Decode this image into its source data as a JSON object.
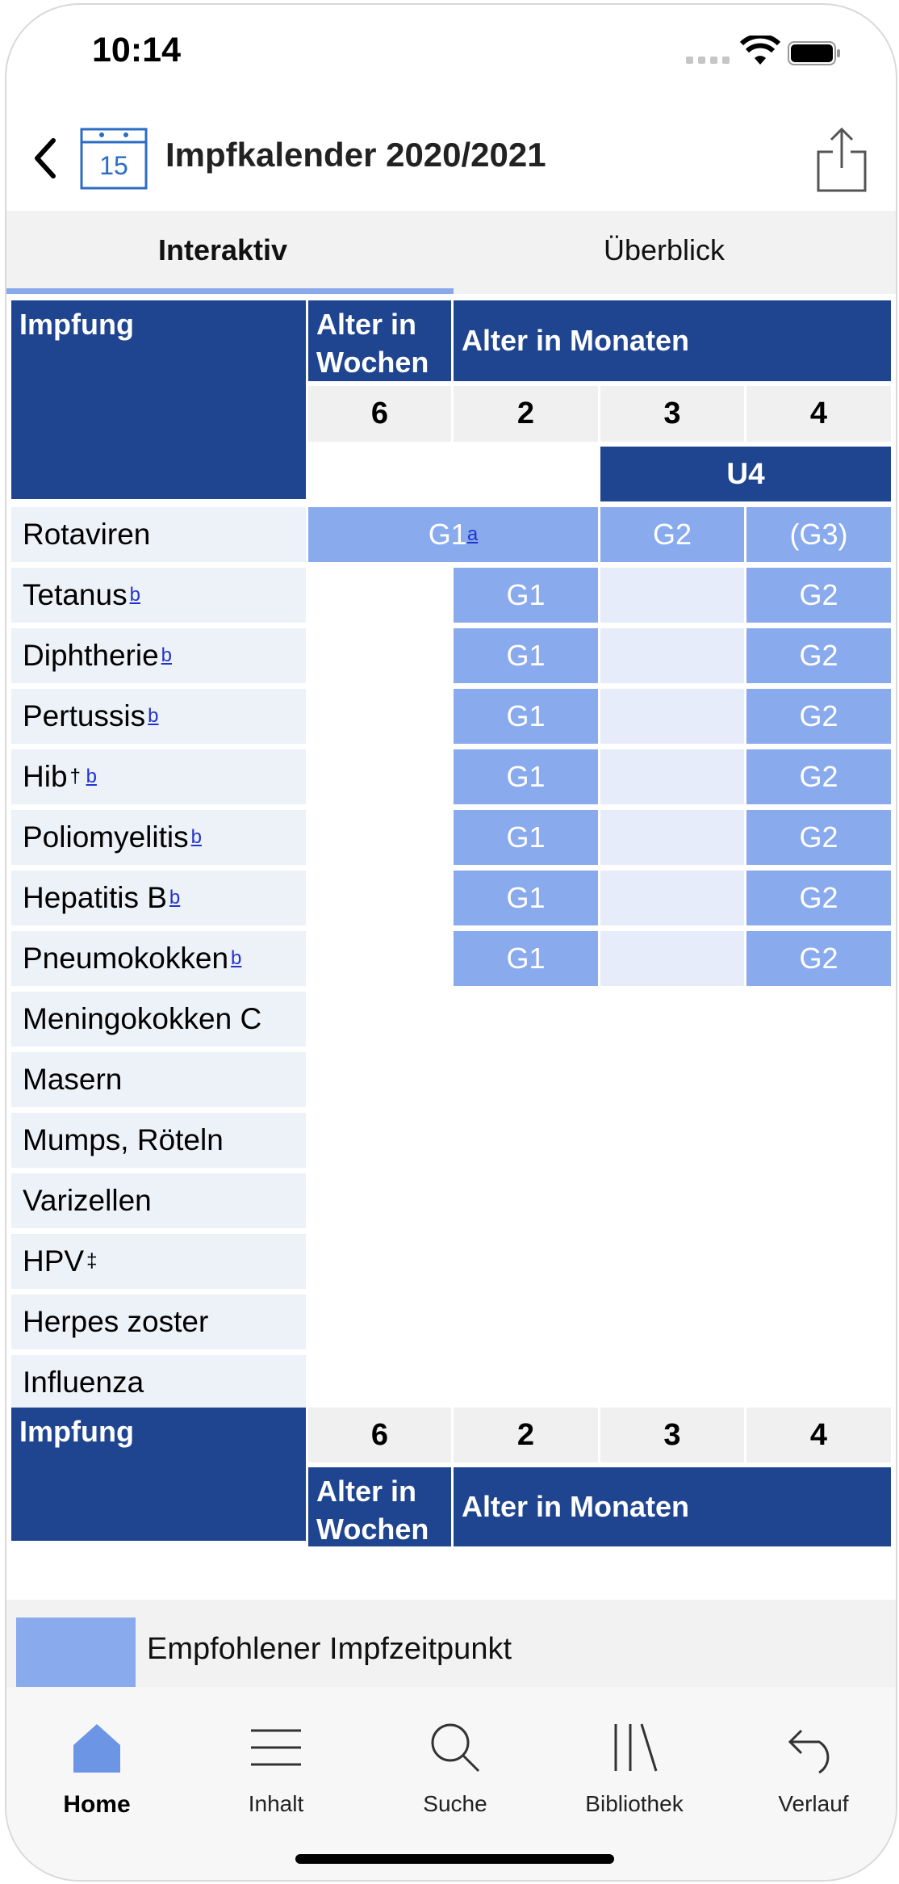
{
  "status_bar": {
    "time": "10:14"
  },
  "nav": {
    "title": "Impfkalender 2020/2021",
    "calendar_day": "15"
  },
  "tabs": [
    {
      "label": "Interaktiv",
      "active": true
    },
    {
      "label": "Überblick",
      "active": false
    }
  ],
  "table": {
    "header_impfung": "Impfung",
    "header_weeks": "Alter in Wochen",
    "header_months": "Alter in Monaten",
    "ages": [
      "6",
      "2",
      "3",
      "4"
    ],
    "u_label": "U4",
    "rotaviren": {
      "label": "Rotaviren",
      "g1": "G1",
      "g1_footnote": "a",
      "g2": "G2",
      "g3": "(G3)"
    },
    "rows": [
      {
        "label": "Tetanus",
        "sup": "b",
        "sup_prefix": "",
        "g1": "G1",
        "g2": "G2"
      },
      {
        "label": "Diphtherie",
        "sup": "b",
        "sup_prefix": "",
        "g1": "G1",
        "g2": "G2"
      },
      {
        "label": "Pertussis",
        "sup": "b",
        "sup_prefix": "",
        "g1": "G1",
        "g2": "G2"
      },
      {
        "label": "Hib",
        "sup": "b",
        "sup_prefix": "†",
        "g1": "G1",
        "g2": "G2"
      },
      {
        "label": "Poliomyelitis",
        "sup": "b",
        "sup_prefix": "",
        "g1": "G1",
        "g2": "G2"
      },
      {
        "label": "Hepatitis B",
        "sup": "b",
        "sup_prefix": "",
        "g1": "G1",
        "g2": "G2"
      },
      {
        "label": "Pneumokokken",
        "sup": "b",
        "sup_prefix": "",
        "g1": "G1",
        "g2": "G2"
      }
    ],
    "other_rows": [
      {
        "label": "Meningokokken C",
        "sup": ""
      },
      {
        "label": "Masern",
        "sup": ""
      },
      {
        "label": "Mumps, Röteln",
        "sup": ""
      },
      {
        "label": "Varizellen",
        "sup": ""
      },
      {
        "label": "HPV",
        "sup": "‡"
      },
      {
        "label": "Herpes zoster",
        "sup": ""
      },
      {
        "label": "Influenza",
        "sup": ""
      }
    ]
  },
  "legend": {
    "text": "Empfohlener Impfzeitpunkt"
  },
  "tabbar": [
    {
      "label": "Home",
      "icon": "home-icon",
      "active": true
    },
    {
      "label": "Inhalt",
      "icon": "menu-icon",
      "active": false
    },
    {
      "label": "Suche",
      "icon": "search-icon",
      "active": false
    },
    {
      "label": "Bibliothek",
      "icon": "library-icon",
      "active": false
    },
    {
      "label": "Verlauf",
      "icon": "history-icon",
      "active": false
    }
  ],
  "colors": {
    "header_blue": "#1f4590",
    "dose_blue": "#8aaaee",
    "row_bg": "#edf1f8",
    "tab_underline": "#8aa9ea"
  }
}
